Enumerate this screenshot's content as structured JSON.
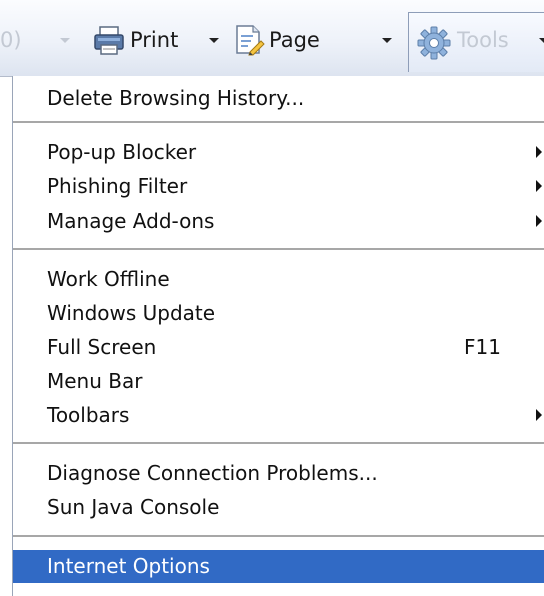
{
  "toolbar": {
    "partial_left_text": "0)",
    "print_label": "Print",
    "page_label": "Page",
    "tools_label": "Tools"
  },
  "menu": {
    "item_0": {
      "label": "Delete Browsing History..."
    },
    "item_1": {
      "label": "Pop-up Blocker"
    },
    "item_2": {
      "label": "Phishing Filter"
    },
    "item_3": {
      "label": "Manage Add-ons"
    },
    "item_4": {
      "label": "Work Offline"
    },
    "item_5": {
      "label": "Windows Update"
    },
    "item_6": {
      "label": "Full Screen",
      "shortcut": "F11"
    },
    "item_7": {
      "label": "Menu Bar"
    },
    "item_8": {
      "label": "Toolbars"
    },
    "item_9": {
      "label": "Diagnose Connection Problems..."
    },
    "item_10": {
      "label": "Sun Java Console"
    },
    "item_11": {
      "label": "Internet Options"
    }
  },
  "colors": {
    "highlight": "#316ac5",
    "highlight_text": "#ffffff",
    "separator": "#a7a7a7"
  }
}
